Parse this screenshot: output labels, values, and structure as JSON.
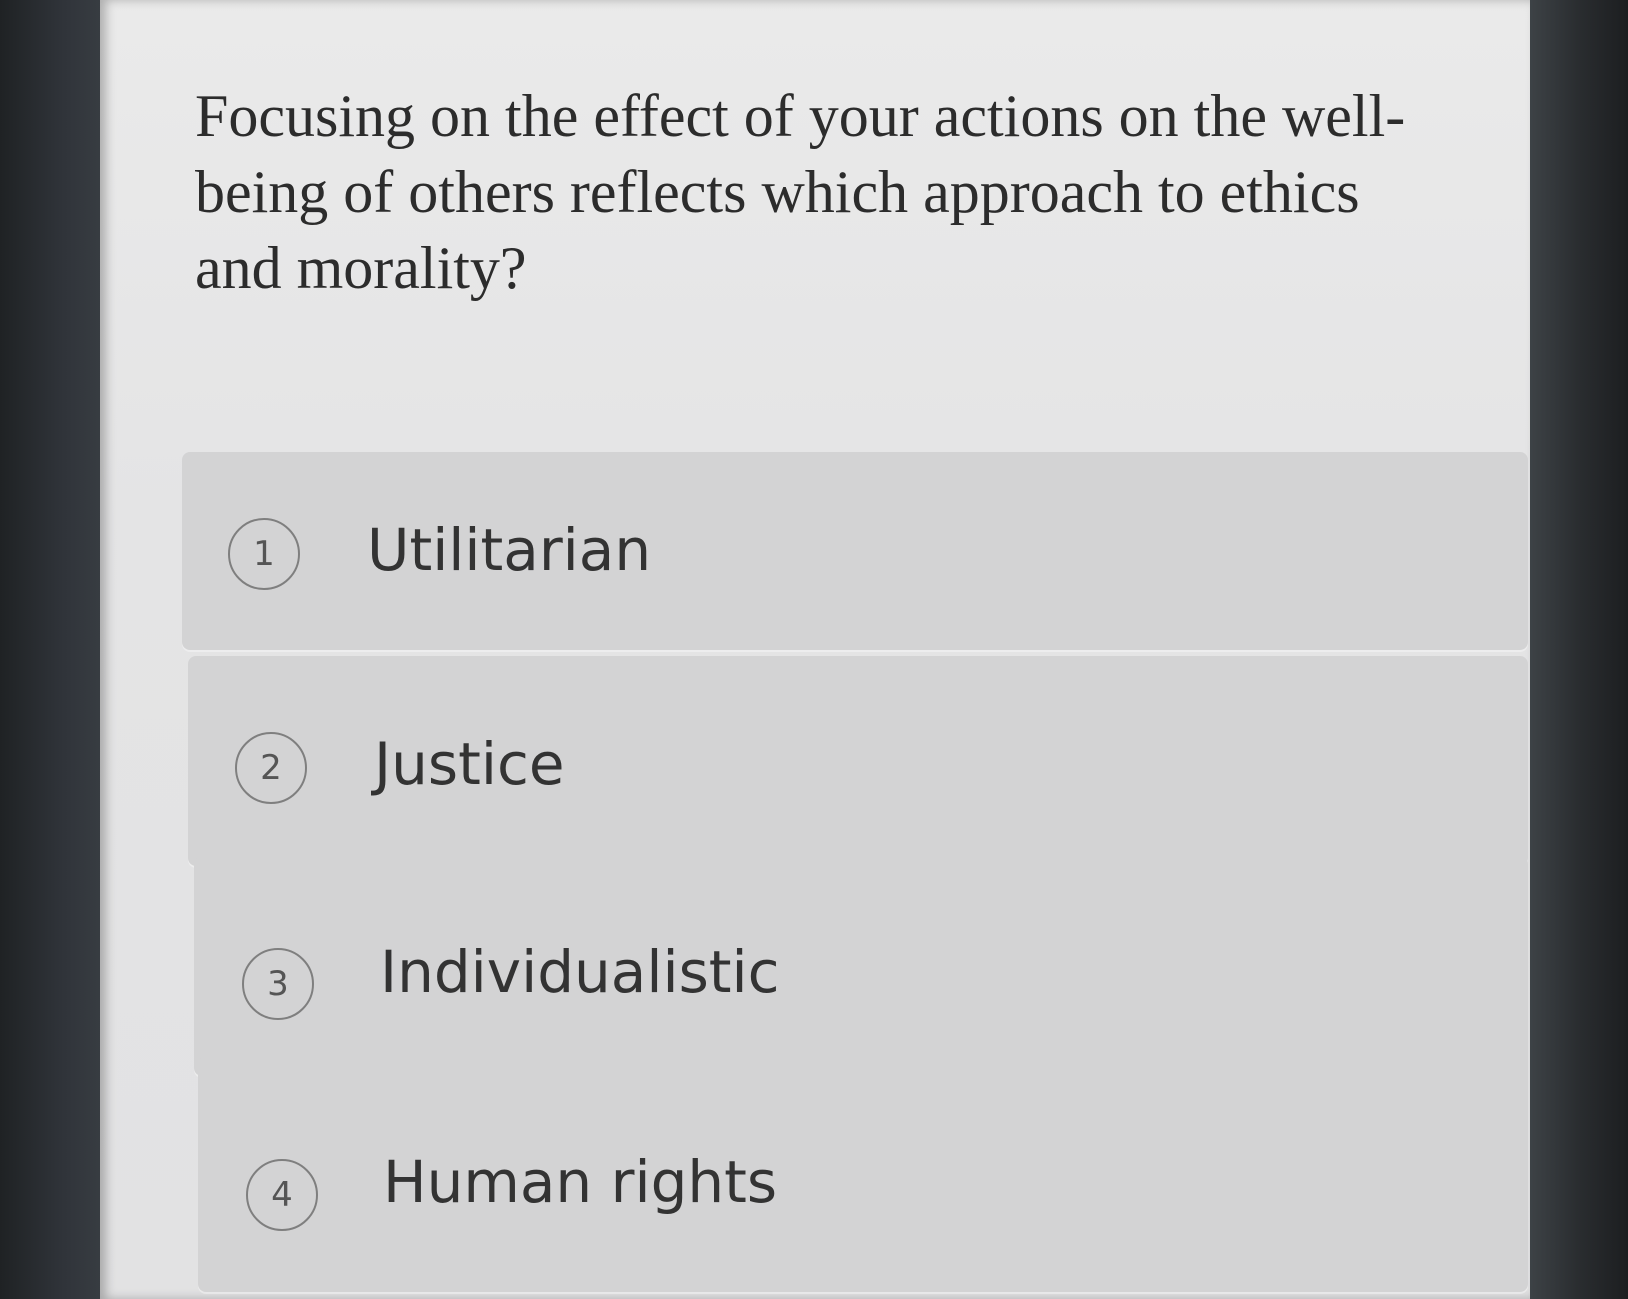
{
  "question": {
    "text": "Focusing on the effect of your actions on the well-being of others reflects which approach to ethics and morality?"
  },
  "options": [
    {
      "number": "1",
      "label": "Utilitarian"
    },
    {
      "number": "2",
      "label": "Justice"
    },
    {
      "number": "3",
      "label": "Individualistic"
    },
    {
      "number": "4",
      "label": "Human rights"
    }
  ],
  "colors": {
    "option_background": "#d3d3d4",
    "screen_background": "#e6e6e6",
    "text": "#333333"
  }
}
